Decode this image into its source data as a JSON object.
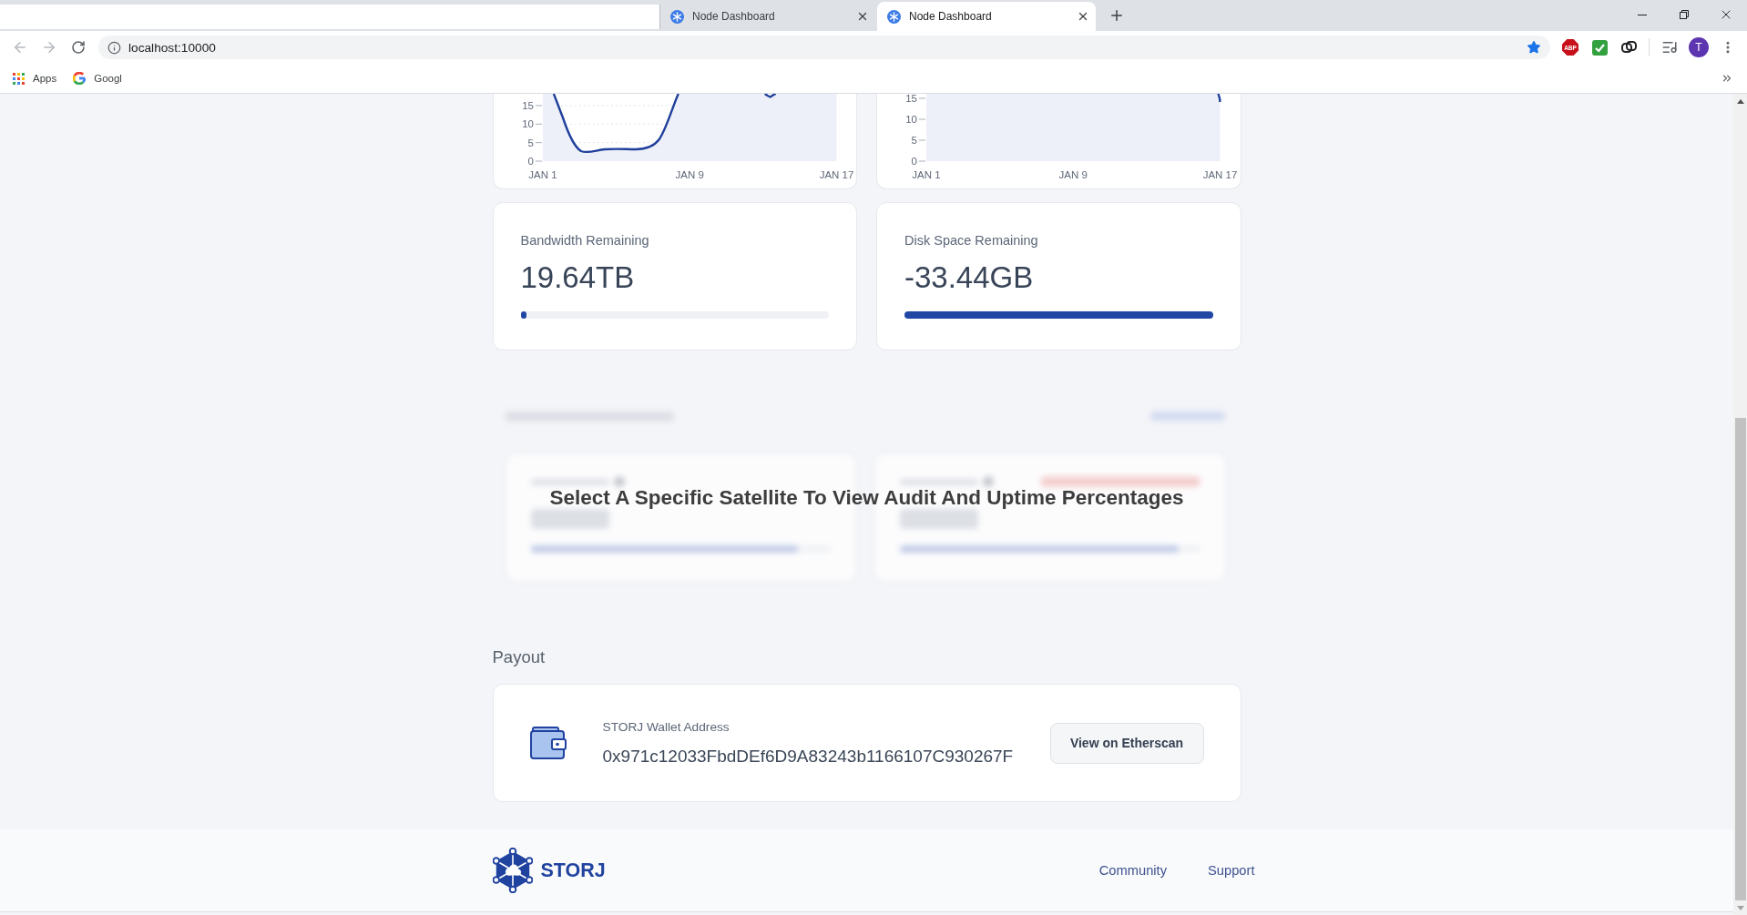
{
  "browser": {
    "tabs": [
      {
        "title": "Node Dashboard",
        "selected": false
      },
      {
        "title": "Node Dashboard",
        "selected": true
      }
    ],
    "navigation": {
      "back_disabled": true,
      "forward_disabled": true
    },
    "address": "localhost:10000",
    "extension_badge": "ABP",
    "profile_initial": "T",
    "bookmarks": [
      {
        "kind": "apps",
        "label": "Apps"
      },
      {
        "kind": "site",
        "label": "Googl"
      }
    ]
  },
  "charts": [
    {
      "kind": "dip",
      "y_ticks": [
        "15",
        "10",
        "5",
        "0"
      ],
      "x_ticks": [
        "JAN 1",
        "JAN 9",
        "JAN 17"
      ]
    },
    {
      "kind": "drop",
      "y_ticks": [
        "15",
        "10",
        "5",
        "0"
      ],
      "x_ticks": [
        "JAN 1",
        "JAN 9",
        "JAN 17"
      ]
    }
  ],
  "stats": [
    {
      "label": "Bandwidth Remaining",
      "value": "19.64TB",
      "level": 0.02
    },
    {
      "label": "Disk Space Remaining",
      "value": "-33.44GB",
      "level": 1
    }
  ],
  "audit": {
    "blurred_cards": [
      {
        "level": 0.89,
        "badge": false
      },
      {
        "level": 0.93,
        "badge": true
      }
    ],
    "overlay_message": "Select A Specific Satellite To View Audit And Uptime Percentages"
  },
  "payout": {
    "title": "Payout",
    "wallet_label": "STORJ Wallet Address",
    "wallet_address": "0x971c12033FbdDEf6D9A83243b1166107C930267F",
    "button": "View on Etherscan"
  },
  "footer": {
    "logo_text": "STORJ",
    "links": [
      "Community",
      "Support"
    ]
  }
}
